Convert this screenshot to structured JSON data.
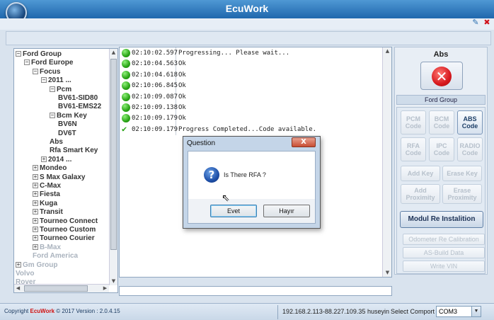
{
  "app": {
    "title": "EcuWork"
  },
  "tree": {
    "nodes": [
      {
        "label": "Ford Group",
        "expander": "−",
        "grey": false
      },
      {
        "label": "Ford Europe",
        "expander": "−",
        "grey": false
      },
      {
        "label": "Focus",
        "expander": "−",
        "grey": false
      },
      {
        "label": "2011 ...",
        "expander": "−",
        "grey": false
      },
      {
        "label": "Pcm",
        "expander": "−",
        "grey": false
      },
      {
        "label": "BV61-SID80",
        "expander": "",
        "grey": false
      },
      {
        "label": "BV61-EMS22",
        "expander": "",
        "grey": false
      },
      {
        "label": "Bcm Key",
        "expander": "−",
        "grey": false
      },
      {
        "label": "BV6N",
        "expander": "",
        "grey": false
      },
      {
        "label": "DV6T",
        "expander": "",
        "grey": false
      },
      {
        "label": "Abs",
        "expander": "",
        "grey": false
      },
      {
        "label": "Rfa Smart Key",
        "expander": "",
        "grey": false
      },
      {
        "label": "2014 ...",
        "expander": "+",
        "grey": false
      },
      {
        "label": "Mondeo",
        "expander": "+",
        "grey": false
      },
      {
        "label": "S Max Galaxy",
        "expander": "+",
        "grey": false
      },
      {
        "label": "C-Max",
        "expander": "+",
        "grey": false
      },
      {
        "label": "Fiesta",
        "expander": "+",
        "grey": false
      },
      {
        "label": "Kuga",
        "expander": "+",
        "grey": false
      },
      {
        "label": "Transit",
        "expander": "+",
        "grey": false
      },
      {
        "label": "Tourneo Connect",
        "expander": "+",
        "grey": false
      },
      {
        "label": "Tourneo Custom",
        "expander": "+",
        "grey": false
      },
      {
        "label": "Tourneo Courier",
        "expander": "+",
        "grey": false
      },
      {
        "label": "B-Max",
        "expander": "+",
        "grey": true
      },
      {
        "label": "Ford America",
        "expander": "",
        "grey": true
      },
      {
        "label": "Gm Group",
        "expander": "+",
        "grey": true
      },
      {
        "label": "Volvo",
        "expander": "",
        "grey": true
      },
      {
        "label": "Rover",
        "expander": "",
        "grey": true
      }
    ]
  },
  "log": {
    "rows": [
      {
        "time": "02:10:02.597",
        "message": "Progressing... Please wait...",
        "status": "ok-dot"
      },
      {
        "time": "02:10:04.563",
        "message": "Ok",
        "status": "ok-dot"
      },
      {
        "time": "02:10:04.618",
        "message": "Ok",
        "status": "ok-dot"
      },
      {
        "time": "02:10:06.845",
        "message": "Ok",
        "status": "ok-dot"
      },
      {
        "time": "02:10:09.087",
        "message": "Ok",
        "status": "ok-dot"
      },
      {
        "time": "02:10:09.138",
        "message": "Ok",
        "status": "ok-dot"
      },
      {
        "time": "02:10:09.179",
        "message": "Ok",
        "status": "ok-dot"
      },
      {
        "time": "02:10:09.179",
        "message": "Progress Completed...Code available.",
        "status": "check"
      }
    ]
  },
  "right_panel": {
    "module_title": "Abs",
    "group_label": "Ford Group",
    "code_buttons": [
      {
        "label": "PCM Code",
        "enabled": false
      },
      {
        "label": "BCM Code",
        "enabled": false
      },
      {
        "label": "ABS Code",
        "enabled": true
      },
      {
        "label": "RFA Code",
        "enabled": false
      },
      {
        "label": "IPC Code",
        "enabled": false
      },
      {
        "label": "RADIO Code",
        "enabled": false
      }
    ],
    "key_buttons": [
      {
        "label": "Add Key"
      },
      {
        "label": "Erase Key"
      },
      {
        "label": "Add Proximity"
      },
      {
        "label": "Erase Proximity"
      }
    ],
    "modul_button": "Modul Re Instalition",
    "extra_buttons": [
      {
        "label": "Odometer Re Calibration"
      },
      {
        "label": "AS-Build Data"
      },
      {
        "label": "Write VIN"
      }
    ]
  },
  "status_bar": {
    "copyright_prefix": "Copyright",
    "brand": "EcuWork",
    "copyright_suffix": "© 2017 Version : 2.0.4.15",
    "ip": "192.168.2.113-88.227.109.35",
    "user": "huseyin",
    "comport_label": "Select Comport :",
    "comport_value": "COM3"
  },
  "dialog": {
    "title": "Question",
    "close_label": "X",
    "question": "Is There RFA ?",
    "yes_label": "Evet",
    "no_label": "Hayır"
  },
  "icons": {
    "help": "help-icon",
    "close": "close-icon"
  }
}
